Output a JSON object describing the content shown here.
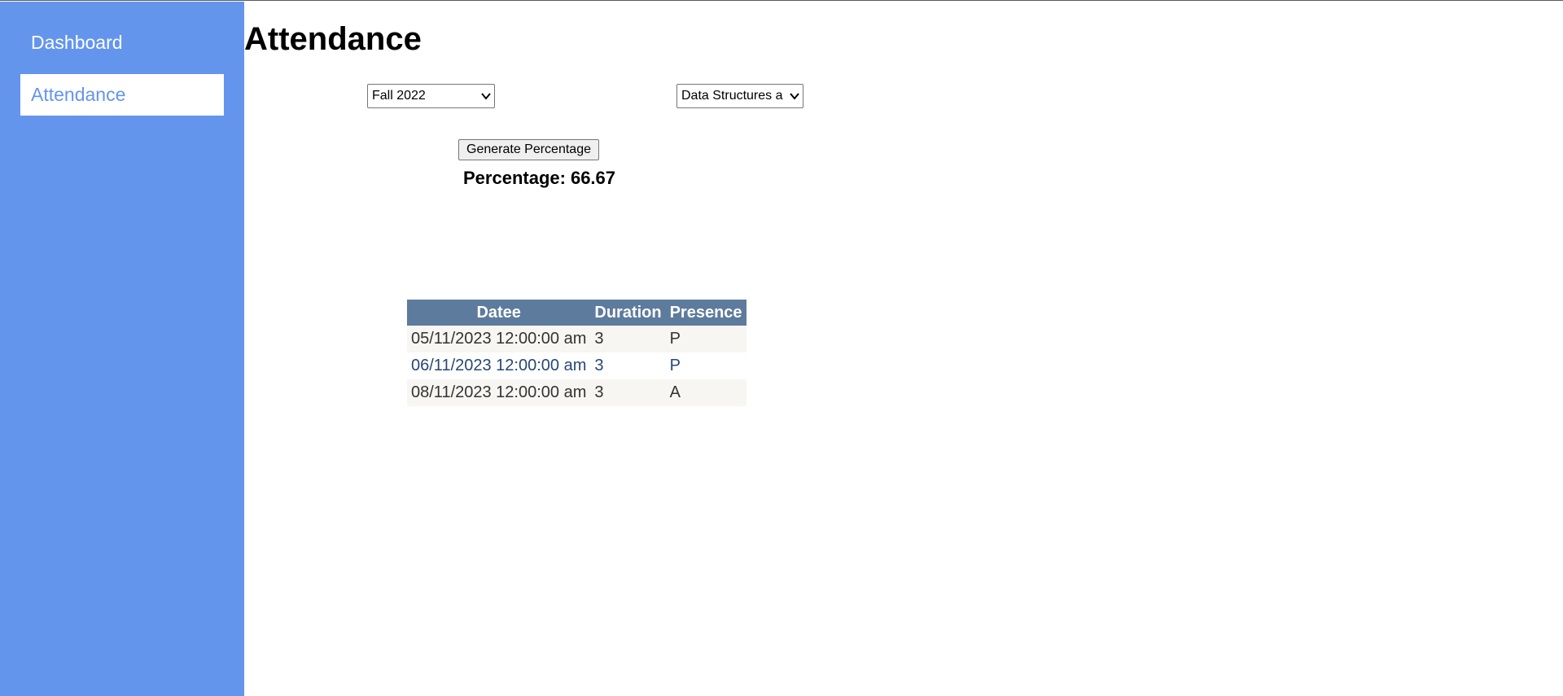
{
  "sidebar": {
    "items": [
      {
        "label": "Dashboard"
      },
      {
        "label": "Attendance"
      }
    ]
  },
  "main": {
    "title": "Attendance",
    "semester_select": {
      "value": "Fall 2022"
    },
    "course_select": {
      "value": "Data Structures a"
    },
    "generate_button": {
      "label": "Generate Percentage"
    },
    "percentage": {
      "label": "Percentage:",
      "value": "66.67"
    }
  },
  "table": {
    "headers": [
      "Datee",
      "Duration",
      "Presence"
    ],
    "rows": [
      {
        "date": "05/11/2023 12:00:00 am",
        "duration": "3",
        "presence": "P"
      },
      {
        "date": "06/11/2023 12:00:00 am",
        "duration": "3",
        "presence": "P"
      },
      {
        "date": "08/11/2023 12:00:00 am",
        "duration": "3",
        "presence": "A"
      }
    ]
  },
  "colors": {
    "sidebar": "#6495ed",
    "table_header": "#5d7b9d",
    "row_alt": "#f7f6f3",
    "row_text_even": "#284775"
  }
}
